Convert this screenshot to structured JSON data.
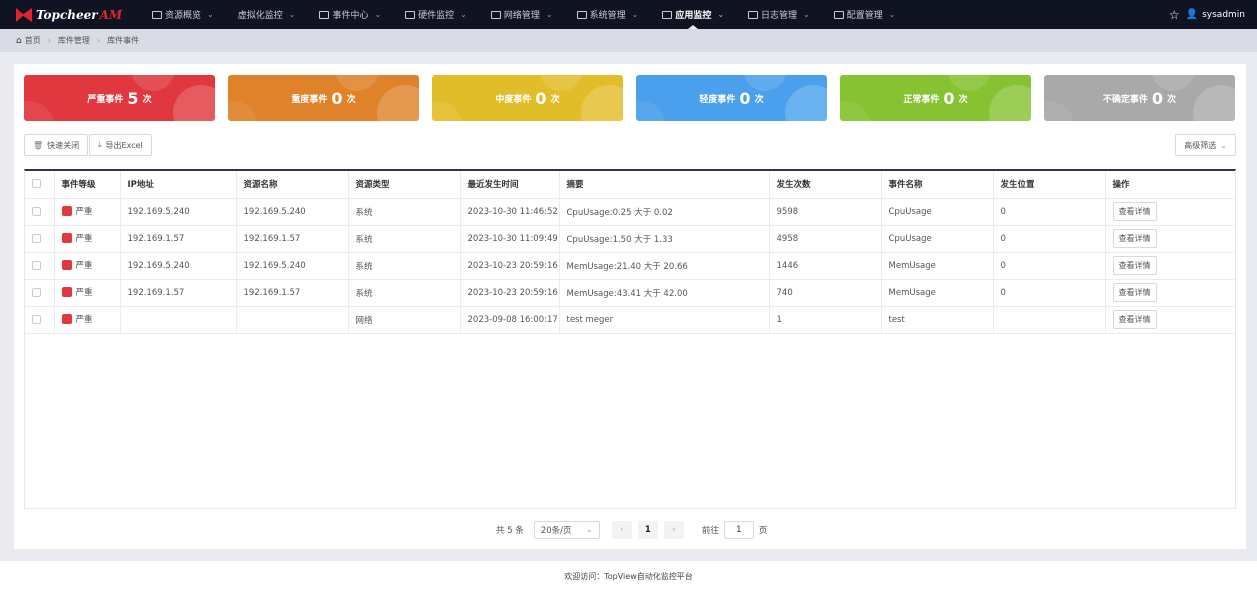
{
  "brand": {
    "name": "Topcheer",
    "suffix": "AM"
  },
  "nav": {
    "items": [
      {
        "label": "资源概览",
        "icon": "monitor-icon",
        "has_icon": true
      },
      {
        "label": "虚拟化监控",
        "icon": "",
        "has_icon": false
      },
      {
        "label": "事件中心",
        "icon": "calendar-icon",
        "has_icon": true
      },
      {
        "label": "硬件监控",
        "icon": "hdd-icon",
        "has_icon": true
      },
      {
        "label": "网络管理",
        "icon": "network-icon",
        "has_icon": true
      },
      {
        "label": "系统管理",
        "icon": "grid-icon",
        "has_icon": true
      },
      {
        "label": "应用监控",
        "icon": "app-icon",
        "has_icon": true,
        "active": true
      },
      {
        "label": "日志管理",
        "icon": "log-icon",
        "has_icon": true
      },
      {
        "label": "配置管理",
        "icon": "settings-icon",
        "has_icon": true
      }
    ],
    "user": "sysadmin"
  },
  "breadcrumb": {
    "home": "首页",
    "level1": "库件管理",
    "level2": "库件事件"
  },
  "cards": [
    {
      "label": "严重事件",
      "count": "5",
      "unit": "次",
      "color": "#e0383e"
    },
    {
      "label": "重度事件",
      "count": "0",
      "unit": "次",
      "color": "#e0822a"
    },
    {
      "label": "中度事件",
      "count": "0",
      "unit": "次",
      "color": "#e2bd2a"
    },
    {
      "label": "轻度事件",
      "count": "0",
      "unit": "次",
      "color": "#4aa0ec"
    },
    {
      "label": "正常事件",
      "count": "0",
      "unit": "次",
      "color": "#86c232"
    },
    {
      "label": "不确定事件",
      "count": "0",
      "unit": "次",
      "color": "#a9a9a9"
    }
  ],
  "toolbar": {
    "quick_close": "快速关闭",
    "export": "导出Excel",
    "filter": "高级筛选"
  },
  "table": {
    "headers": [
      "事件等级",
      "IP地址",
      "资源名称",
      "资源类型",
      "最近发生时间",
      "摘要",
      "发生次数",
      "事件名称",
      "发生位置",
      "操作"
    ],
    "rows": [
      {
        "level": "严重",
        "ip": "192.169.5.240",
        "resource": "192.169.5.240",
        "type": "系统",
        "time": "2023-10-30 11:46:52",
        "summary": "CpuUsage:0.25 大于 0.02",
        "count": "9598",
        "event": "CpuUsage",
        "position": "0",
        "action": "查看详情"
      },
      {
        "level": "严重",
        "ip": "192.169.1.57",
        "resource": "192.169.1.57",
        "type": "系统",
        "time": "2023-10-30 11:09:49",
        "summary": "CpuUsage:1.50 大于 1.33",
        "count": "4958",
        "event": "CpuUsage",
        "position": "0",
        "action": "查看详情"
      },
      {
        "level": "严重",
        "ip": "192.169.5.240",
        "resource": "192.169.5.240",
        "type": "系统",
        "time": "2023-10-23 20:59:16",
        "summary": "MemUsage:21.40 大于 20.66",
        "count": "1446",
        "event": "MemUsage",
        "position": "0",
        "action": "查看详情"
      },
      {
        "level": "严重",
        "ip": "192.169.1.57",
        "resource": "192.169.1.57",
        "type": "系统",
        "time": "2023-10-23 20:59:16",
        "summary": "MemUsage:43.41 大于 42.00",
        "count": "740",
        "event": "MemUsage",
        "position": "0",
        "action": "查看详情"
      },
      {
        "level": "严重",
        "ip": "",
        "resource": "",
        "type": "网络",
        "time": "2023-09-08 16:00:17",
        "summary": "test meger",
        "count": "1",
        "event": "test",
        "position": "",
        "action": "查看详情"
      }
    ]
  },
  "pagination": {
    "total": "共 5 条",
    "page_size": "20条/页",
    "current": "1",
    "goto_label": "前往",
    "goto_value": "1",
    "page_unit": "页"
  },
  "footer": "欢迎访问：TopView自动化监控平台"
}
